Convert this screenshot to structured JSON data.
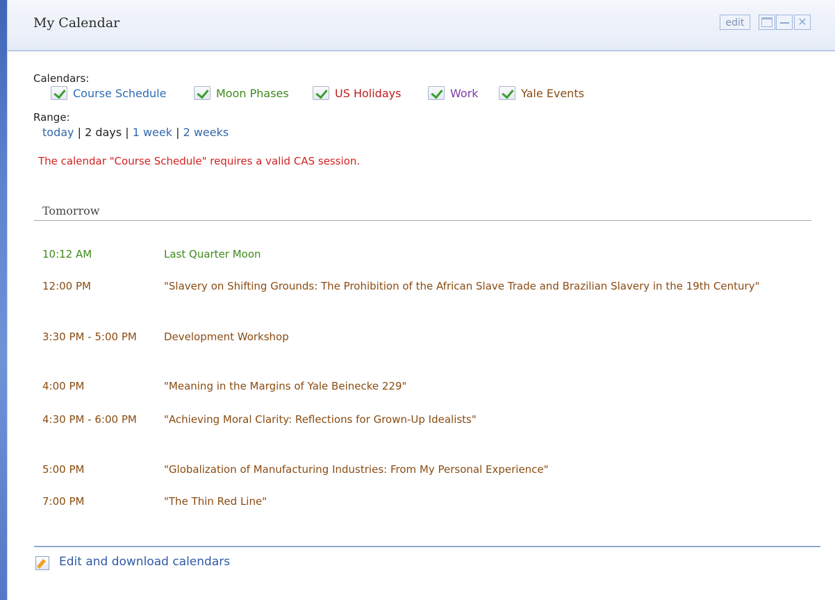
{
  "portlet": {
    "title": "My Calendar",
    "controls": {
      "edit_label": "edit",
      "close_glyph": "✕"
    }
  },
  "calendars": {
    "label": "Calendars:",
    "items": [
      {
        "label": "Course Schedule",
        "color": "#2f6db5",
        "checked": true
      },
      {
        "label": "Moon Phases",
        "color": "#3d8a1a",
        "checked": true
      },
      {
        "label": "US Holidays",
        "color": "#c21b1b",
        "checked": true
      },
      {
        "label": "Work",
        "color": "#7a3aa8",
        "checked": true
      },
      {
        "label": "Yale Events",
        "color": "#8a4c12",
        "checked": true
      }
    ]
  },
  "range": {
    "label": "Range:",
    "options": [
      "today",
      "2 days",
      "1 week",
      "2 weeks"
    ],
    "separator": "|",
    "selected": "2 days"
  },
  "warning": "The calendar \"Course Schedule\" requires a valid CAS session.",
  "day": {
    "title": "Tomorrow",
    "events": [
      {
        "time": "10:12 AM",
        "title": "Last Quarter Moon",
        "calendar": "Moon Phases"
      },
      {
        "time": "12:00 PM",
        "title": "\"Slavery on Shifting Grounds: The Prohibition of the African Slave Trade and Brazilian Slavery in the 19th Century\"",
        "calendar": "Yale Events"
      },
      {
        "time": "3:30 PM - 5:00 PM",
        "title": "Development Workshop",
        "calendar": "Yale Events"
      },
      {
        "time": "4:00 PM",
        "title": "\"Meaning in the Margins of Yale Beinecke 229\"",
        "calendar": "Yale Events"
      },
      {
        "time": "4:30 PM - 6:00 PM",
        "title": "\"Achieving Moral Clarity: Reflections for Grown-Up Idealists\"",
        "calendar": "Yale Events"
      },
      {
        "time": "5:00 PM",
        "title": "\"Globalization of Manufacturing Industries: From My Personal Experience\"",
        "calendar": "Yale Events"
      },
      {
        "time": "7:00 PM",
        "title": "\"The Thin Red Line\"",
        "calendar": "Yale Events"
      }
    ]
  },
  "footer": {
    "edit_link": "Edit and download calendars",
    "icon": "edit-pencil-icon"
  }
}
